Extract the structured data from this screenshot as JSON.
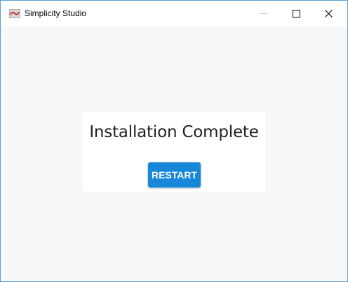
{
  "window": {
    "title": "Simplicity Studio",
    "app_icon": "simplicity-studio-logo",
    "controls": {
      "minimize_icon": "minimize-icon",
      "maximize_icon": "maximize-icon",
      "close_icon": "close-icon"
    }
  },
  "main": {
    "heading": "Installation Complete",
    "restart_label": "RESTART"
  },
  "colors": {
    "accent": "#1687d9",
    "window_border": "#5a9fd4",
    "background": "#f8f8f8"
  }
}
